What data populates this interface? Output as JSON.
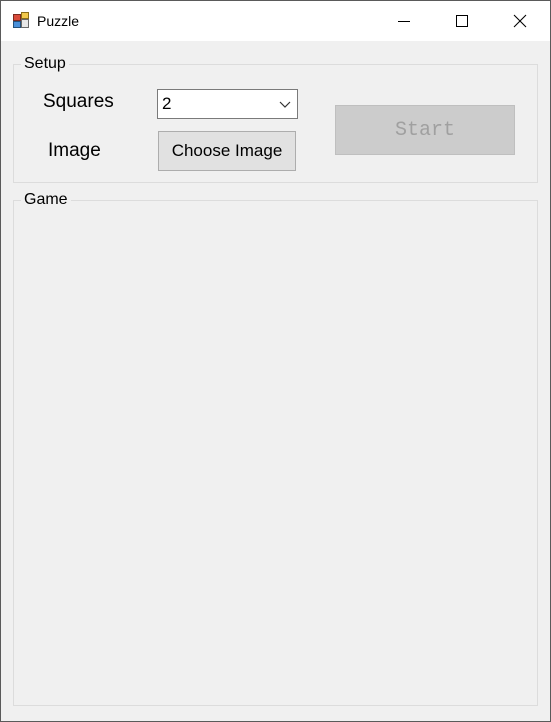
{
  "window": {
    "title": "Puzzle",
    "icon": "puzzle-app-icon"
  },
  "caption_buttons": {
    "minimize_icon": "minimize-icon",
    "maximize_icon": "maximize-icon",
    "close_icon": "close-icon"
  },
  "setup": {
    "legend": "Setup",
    "squares_label": "Squares",
    "squares_value": "2",
    "image_label": "Image",
    "choose_image_label": "Choose Image",
    "start_label": "Start"
  },
  "game": {
    "legend": "Game"
  },
  "colors": {
    "window_bg": "#f0f0f0",
    "titlebar_bg": "#ffffff",
    "button_bg": "#e1e1e1",
    "disabled_button_bg": "#cccccc",
    "disabled_text": "#a0a0a0"
  }
}
